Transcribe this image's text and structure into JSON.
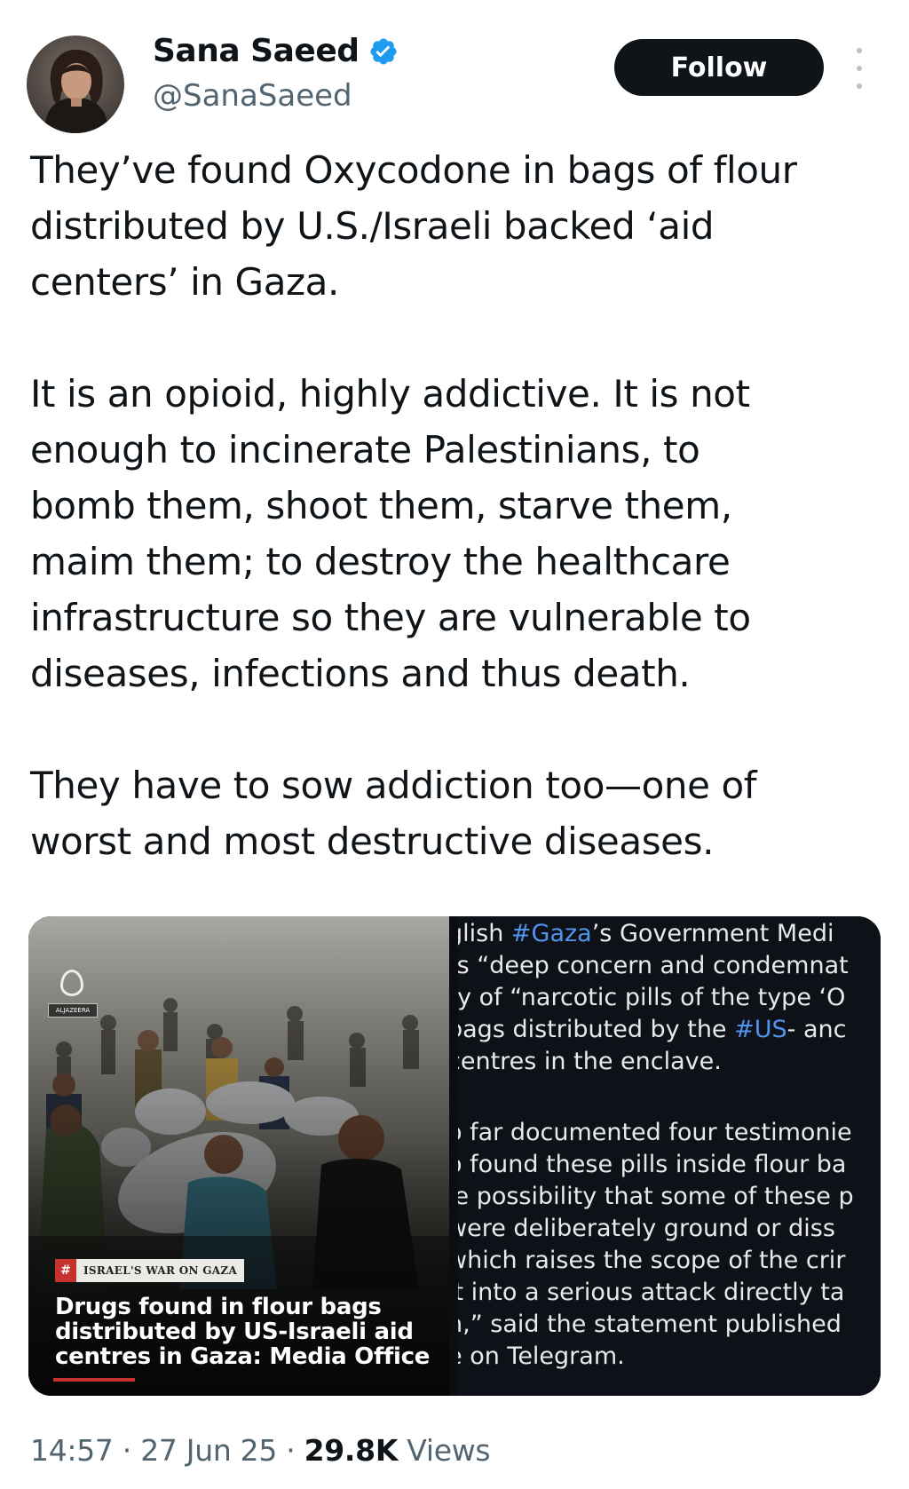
{
  "author": {
    "display_name": "Sana Saeed",
    "handle": "@SanaSaeed",
    "verified_icon": "verified-badge-icon",
    "avatar": "profile-avatar"
  },
  "actions": {
    "follow_label": "Follow",
    "more_icon": "more-vertical-icon"
  },
  "tweet": {
    "paragraphs": [
      "They’ve found Oxycodone in bags of flour\ndistributed by U.S./Israeli backed ‘aid\ncenters’ in Gaza.",
      "It is an opioid, highly addictive. It is not\nenough to incinerate Palestinians, to\nbomb them, shoot them, starve them,\nmaim them; to destroy the healthcare\ninfrastructure so they are vulnerable to\ndiseases, infections and thus death.",
      "They have to sow addiction too—one of\nworst and most destructive diseases."
    ]
  },
  "media": {
    "left": {
      "logo_text": "ALJAZEERA",
      "badge_hash": "#",
      "badge_label": "ISRAEL'S WAR ON GAZA",
      "headline": "Drugs found in flour bags distributed by US-Israeli aid centres in Gaza: Media Office"
    },
    "right": {
      "para1": {
        "line1_a": "glish ",
        "line1_tag": "#Gaza",
        "line1_b": "’s Government Medi",
        "line2": "ts “deep concern and condemnat",
        "line3": "ry of “narcotic pills of the type ‘O",
        "line4_a": "bags distributed by the ",
        "line4_tag": "#US",
        "line4_b": "- anc",
        "line5": "centres in the enclave."
      },
      "para2": {
        "line1": "o far documented four testimonie",
        "line2": "o found these pills inside flour ba",
        "line3": "ie possibility that some of these p",
        "line4": " were deliberately ground or diss",
        "line5": "which raises the scope of the crir",
        "line6": "it into a serious attack directly ta",
        "line7": "h,” said the statement published",
        "line8": "e on Telegram."
      }
    }
  },
  "footer": {
    "time": "14:57",
    "sep1": " · ",
    "date": "27 Jun 25",
    "sep2": " · ",
    "views_count": "29.8K",
    "views_label": " Views"
  },
  "colors": {
    "follow_bg": "#0f1419",
    "verified": "#1d9bf0",
    "hashtag": "#4f94ee",
    "muted_text": "#536471"
  }
}
